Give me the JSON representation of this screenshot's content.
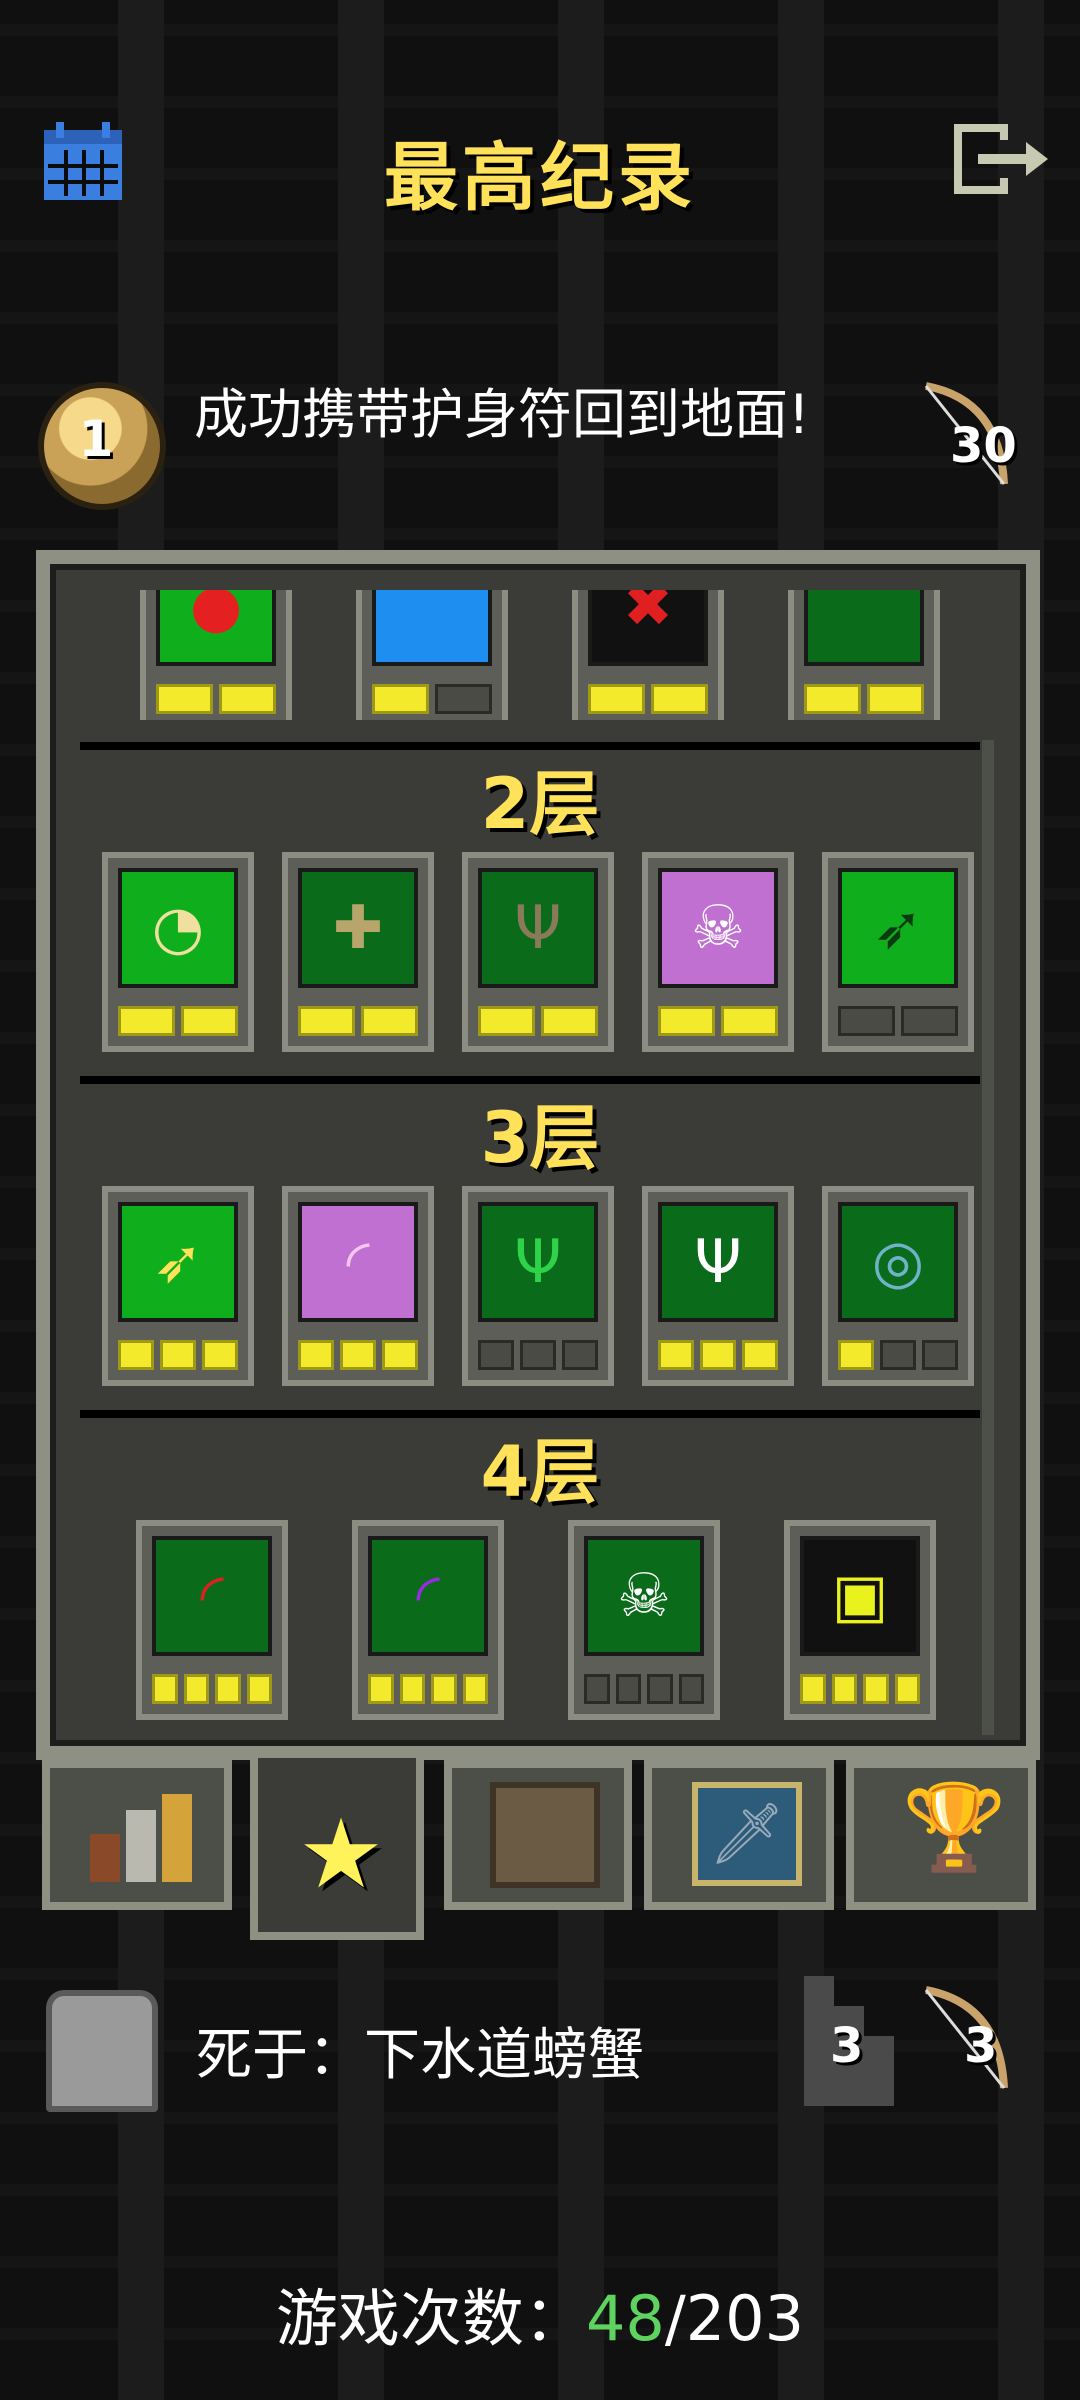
{
  "header": {
    "title": "最高纪录",
    "calendar_icon": "calendar-icon",
    "exit_icon": "exit-icon"
  },
  "record": {
    "rank": "1",
    "text": "成功携带护身符回到地面!",
    "score": "30"
  },
  "panel": {
    "top_row_pips": [
      [
        true,
        true
      ],
      [
        true,
        false
      ],
      [
        true,
        true
      ],
      [
        true,
        true
      ]
    ],
    "floors": [
      {
        "label": "2层"
      },
      {
        "label": "3层"
      },
      {
        "label": "4层"
      }
    ]
  },
  "tabs": [
    "rankings-tab-icon",
    "badges-star-icon",
    "chest-icon",
    "sword-card-icon",
    "trophy-icon"
  ],
  "death": {
    "text": "死于：下水道螃蟹",
    "depth": "3",
    "level": "3"
  },
  "games": {
    "label": "游戏次数：",
    "won": "48",
    "separator": "/",
    "total": "203"
  },
  "colors": {
    "accent_yellow": "#ffe25a",
    "pip_on": "#f2ea2a",
    "green_count": "#5fd35f",
    "panel_bg": "#3b3c37"
  }
}
